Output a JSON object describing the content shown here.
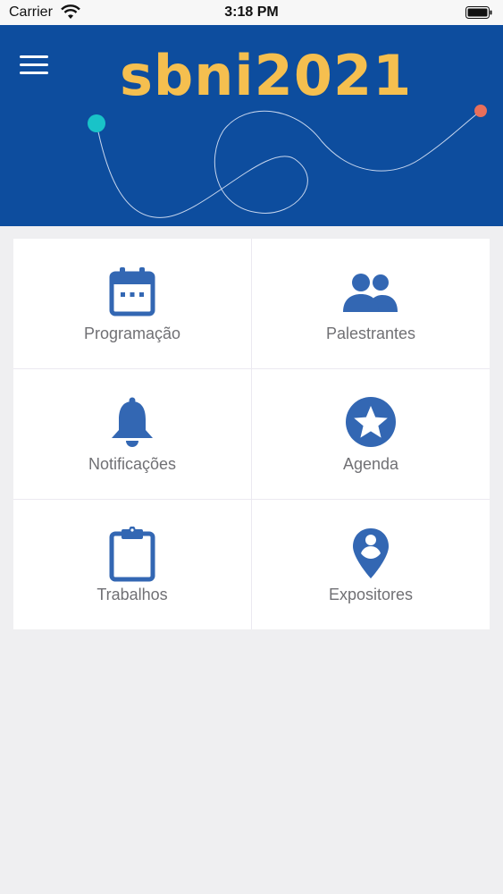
{
  "status_bar": {
    "carrier": "Carrier",
    "time": "3:18 PM"
  },
  "header": {
    "logo_text": "sbni2021",
    "brand_color": "#0d4d9e",
    "logo_color": "#f5bf4f"
  },
  "grid": {
    "icon_color": "#3367b3",
    "items": [
      {
        "label": "Programação",
        "icon": "calendar-icon"
      },
      {
        "label": "Palestrantes",
        "icon": "people-icon"
      },
      {
        "label": "Notificações",
        "icon": "bell-icon"
      },
      {
        "label": "Agenda",
        "icon": "star-icon"
      },
      {
        "label": "Trabalhos",
        "icon": "clipboard-icon"
      },
      {
        "label": "Expositores",
        "icon": "location-pin-icon"
      }
    ]
  }
}
